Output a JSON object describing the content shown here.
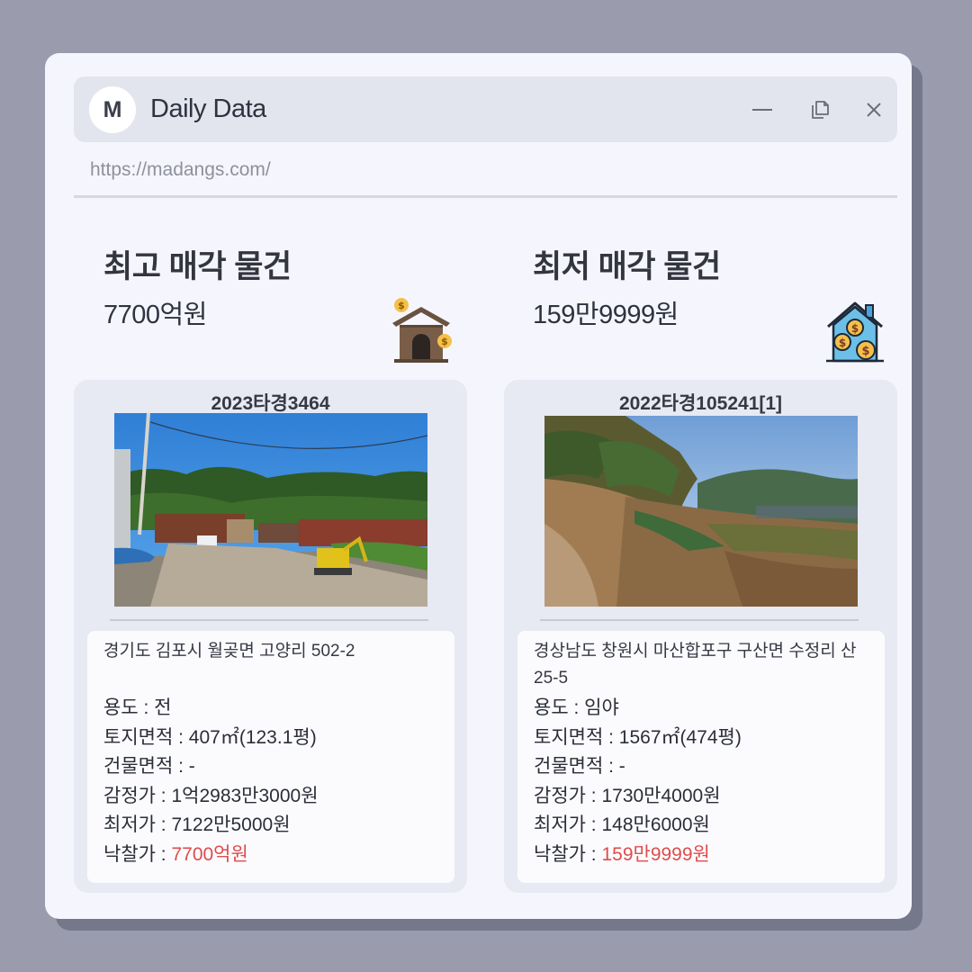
{
  "window": {
    "avatar_letter": "M",
    "title": "Daily Data",
    "url": "https://madangs.com/"
  },
  "highest": {
    "section_title": "최고 매각 물건",
    "amount": "7700억원",
    "case_no": "2023타경3464",
    "address": "경기도 김포시 월곶면 고양리 502-2",
    "usage_label": "용도 : ",
    "usage": "전",
    "land_label": "토지면적 : ",
    "land_area": "407㎡(123.1평)",
    "building_label": "건물면적 : ",
    "building_area": "-",
    "appraisal_label": "감정가 : ",
    "appraisal": "1억2983만3000원",
    "minimum_label": "최저가 : ",
    "minimum": "7122만5000원",
    "winning_label": "낙찰가 : ",
    "winning": "7700억원"
  },
  "lowest": {
    "section_title": "최저 매각 물건",
    "amount": "159만9999원",
    "case_no": "2022타경105241[1]",
    "address": "경상남도 창원시 마산합포구 구산면 수정리 산25-5",
    "usage_label": "용도 : ",
    "usage": "임야",
    "land_label": "토지면적 : ",
    "land_area": "1567㎡(474평)",
    "building_label": "건물면적 : ",
    "building_area": "-",
    "appraisal_label": "감정가 : ",
    "appraisal": "1730만4000원",
    "minimum_label": "최저가 : ",
    "minimum": "148만6000원",
    "winning_label": "낙찰가 : ",
    "winning": "159만9999원"
  },
  "icons": {
    "minimize": "minimize-icon",
    "restore": "restore-icon",
    "close": "close-icon",
    "highest_hero": "money-house-icon",
    "lowest_hero": "house-coins-icon"
  },
  "colors": {
    "accent_red": "#e04b4b",
    "background": "#9a9cae",
    "window": "#f5f6fd"
  }
}
